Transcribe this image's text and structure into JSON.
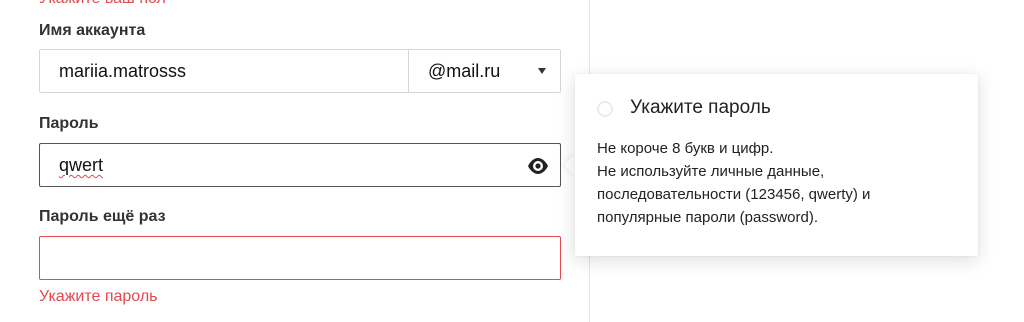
{
  "form": {
    "top_error_text": "Укажите ваш пол",
    "account": {
      "label": "Имя аккаунта",
      "value": "mariia.matrosss",
      "domain": "@mail.ru"
    },
    "password": {
      "label": "Пароль",
      "value": "qwert",
      "toggle_icon": "eye-icon"
    },
    "password_repeat": {
      "label": "Пароль ещё раз",
      "value": "",
      "error": "Укажите пароль"
    }
  },
  "tooltip": {
    "title": "Укажите пароль",
    "lines": [
      "Не короче 8 букв и цифр.",
      "Не используйте личные данные,",
      "последовательности (123456, qwerty) и",
      "популярные пароли (password)."
    ]
  },
  "colors": {
    "error": "#e5484d",
    "border": "#d6d6d6",
    "focused_border": "#555555"
  }
}
